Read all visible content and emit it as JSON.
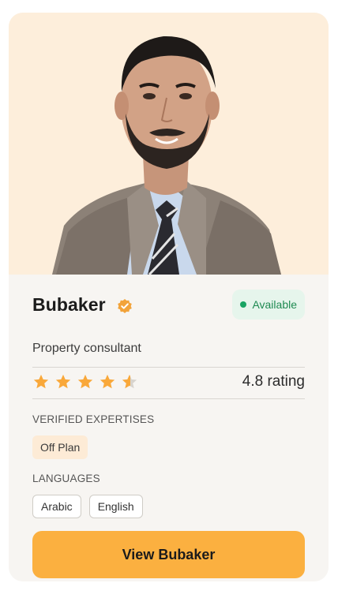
{
  "card": {
    "name": "Bubaker",
    "status": "Available",
    "role": "Property consultant",
    "rating_value": 4.8,
    "rating_label": "4.8 rating",
    "expertise_label": "VERIFIED EXPERTISES",
    "expertises": [
      "Off Plan"
    ],
    "languages_label": "LANGUAGES",
    "languages": [
      "Arabic",
      "English"
    ],
    "cta_label": "View Bubaker"
  },
  "colors": {
    "photo_bg": "#fdeedb",
    "card_bg": "#f7f5f2",
    "accent": "#fbb040",
    "status_green": "#19a463",
    "status_bg": "#e6f5ec",
    "chip_orange_bg": "#fdebd6",
    "star_fill": "#f9a83a",
    "star_empty": "#d8d4ce"
  },
  "icons": {
    "verified": "verified-badge-icon",
    "star": "star-icon",
    "status": "status-dot-icon"
  }
}
